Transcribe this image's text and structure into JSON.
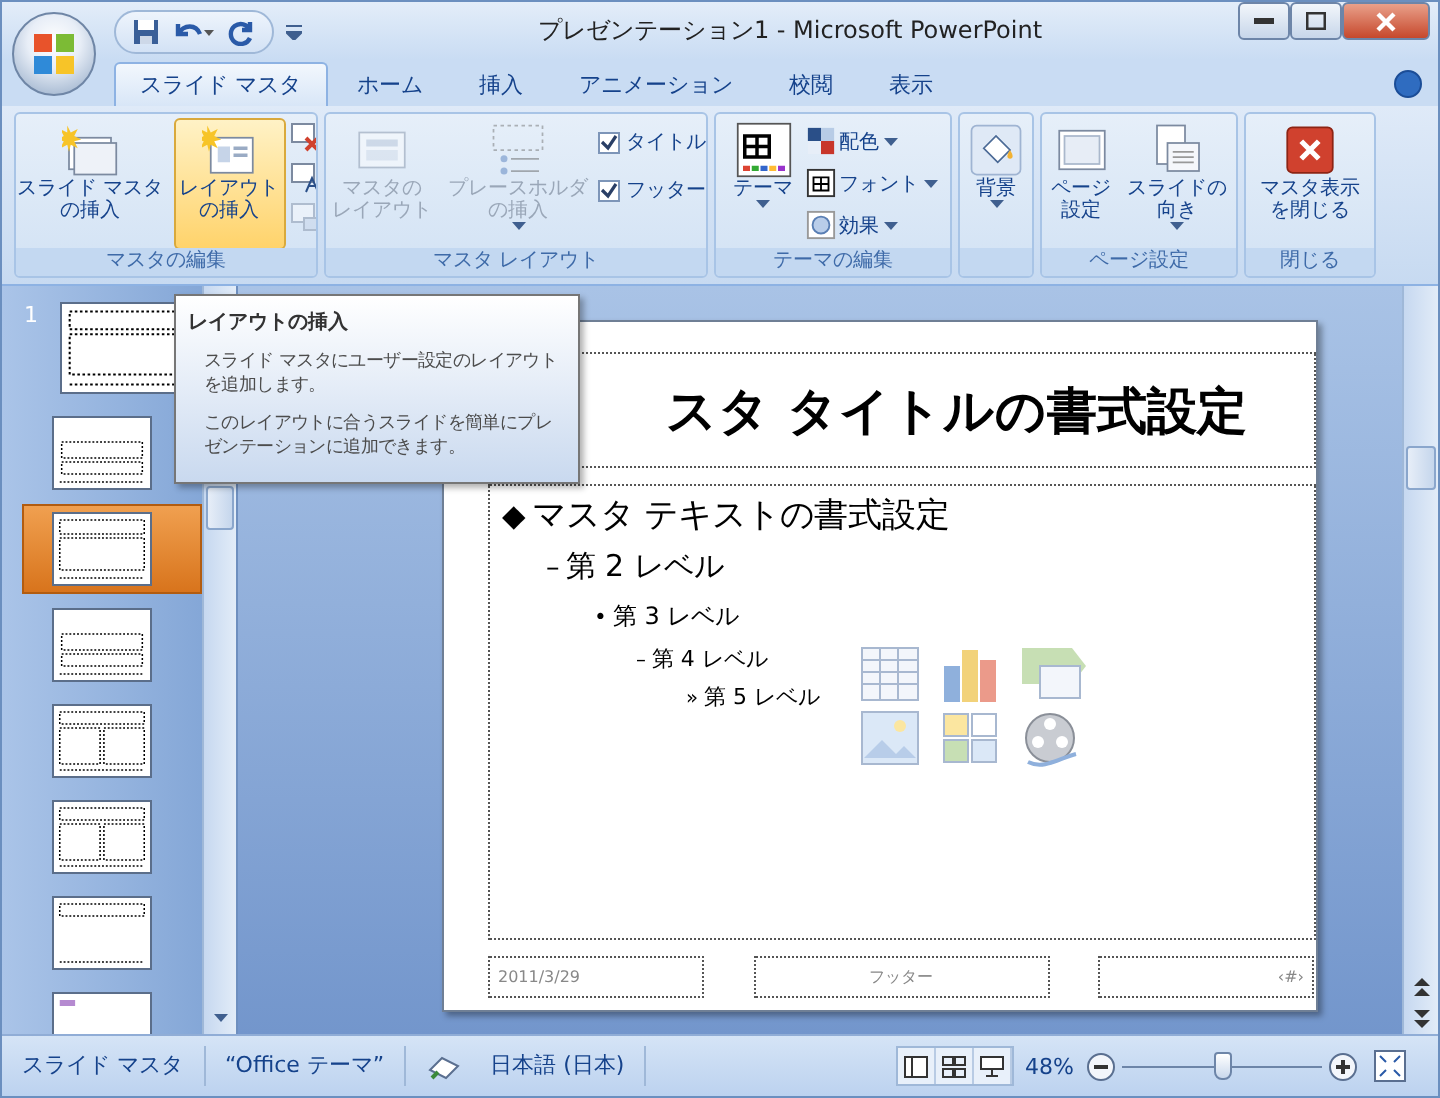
{
  "window": {
    "title": "プレゼンテーション1 - Microsoft PowerPoint"
  },
  "tabs": [
    {
      "label": "スライド マスタ",
      "selected": true
    },
    {
      "label": "ホーム",
      "selected": false
    },
    {
      "label": "挿入",
      "selected": false
    },
    {
      "label": "アニメーション",
      "selected": false
    },
    {
      "label": "校閲",
      "selected": false
    },
    {
      "label": "表示",
      "selected": false
    }
  ],
  "ribbon": [
    {
      "label": "マスタの編集",
      "buttons": [
        {
          "kind": "large",
          "label": [
            "スライド マスタ",
            "の挿入"
          ],
          "disabled": false,
          "highlighted": false,
          "dropdown": false
        },
        {
          "kind": "large",
          "label": [
            "レイアウト",
            "の挿入"
          ],
          "disabled": false,
          "highlighted": true,
          "dropdown": false
        },
        {
          "kind": "icons"
        }
      ]
    },
    {
      "label": "マスタ レイアウト",
      "buttons": [
        {
          "kind": "large",
          "label": [
            "マスタの",
            "レイアウト"
          ],
          "disabled": true,
          "highlighted": false,
          "dropdown": false
        },
        {
          "kind": "large",
          "label": [
            "プレースホルダ",
            "の挿入"
          ],
          "disabled": true,
          "highlighted": false,
          "dropdown": true
        },
        {
          "kind": "checks",
          "items": [
            {
              "label": "タイトル",
              "checked": true
            },
            {
              "label": "フッター",
              "checked": true
            }
          ]
        }
      ]
    },
    {
      "label": "テーマの編集",
      "buttons": [
        {
          "kind": "large",
          "label": [
            "テーマ"
          ],
          "disabled": false,
          "highlighted": false,
          "dropdown": true
        },
        {
          "kind": "small",
          "items": [
            {
              "label": "配色",
              "dropdown": true
            },
            {
              "label": "フォント",
              "dropdown": true
            },
            {
              "label": "効果",
              "dropdown": true
            }
          ]
        }
      ]
    },
    {
      "buttons": [
        {
          "kind": "large",
          "label": [
            "背景"
          ],
          "disabled": false,
          "highlighted": false,
          "dropdown": true
        }
      ]
    },
    {
      "label": "ページ設定",
      "buttons": [
        {
          "kind": "large",
          "label": [
            "ページ",
            "設定"
          ],
          "disabled": false,
          "highlighted": false,
          "dropdown": false
        },
        {
          "kind": "large",
          "label": [
            "スライドの",
            "向き"
          ],
          "disabled": false,
          "highlighted": false,
          "dropdown": true
        }
      ]
    },
    {
      "label": "閉じる",
      "buttons": [
        {
          "kind": "large",
          "label": [
            "マスタ表示",
            "を閉じる"
          ],
          "disabled": false,
          "highlighted": false,
          "dropdown": false
        }
      ]
    }
  ],
  "tooltip": {
    "title": "レイアウトの挿入",
    "paragraphs": [
      "スライド マスタにユーザー設定のレイアウトを追加します。",
      "このレイアウトに合うスライドを簡単にプレゼンテーションに追加できます。"
    ]
  },
  "thumbnails": [
    {
      "number": "1",
      "kind": "master",
      "selected": false
    },
    {
      "kind": "title",
      "selected": false
    },
    {
      "kind": "content",
      "selected": true
    },
    {
      "kind": "section",
      "selected": false
    },
    {
      "kind": "two",
      "selected": false
    },
    {
      "kind": "compare",
      "selected": false
    },
    {
      "kind": "titleonly",
      "selected": false
    },
    {
      "kind": "blank",
      "selected": false
    }
  ],
  "slide": {
    "title": "スタ タイトルの書式設定",
    "body": [
      {
        "bullet": "◆",
        "text": "マスタ テキストの書式設定",
        "children": [
          {
            "bullet": "–",
            "text": "第 2 レベル",
            "children": [
              {
                "bullet": "•",
                "text": "第 3 レベル",
                "children": [
                  {
                    "bullet": "–",
                    "text": "第 4 レベル",
                    "children": [
                      {
                        "bullet": "»",
                        "text": "第 5 レベル"
                      }
                    ]
                  }
                ]
              }
            ]
          }
        ]
      }
    ],
    "date": "2011/3/29",
    "footer": "フッター",
    "page_number": "‹#›"
  },
  "status_bar": {
    "items": [
      "スライド マスタ",
      "“Office テーマ”"
    ],
    "language": "日本語 (日本)",
    "zoom": "48%",
    "zoom_slider": {
      "level": 0.5
    }
  }
}
